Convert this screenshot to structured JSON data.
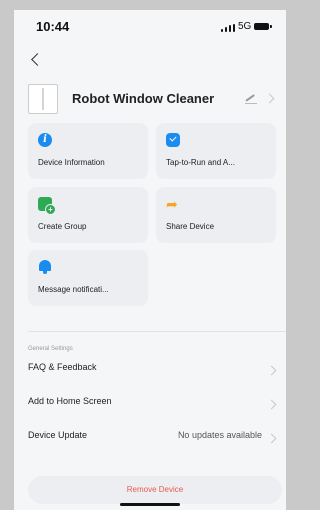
{
  "status_bar": {
    "time": "10:44",
    "network": "5G"
  },
  "header": {
    "back_icon": "chevron-left-icon"
  },
  "device": {
    "name": "Robot Window Cleaner",
    "edit_icon": "pencil-icon"
  },
  "tiles": [
    {
      "label": "Device Information",
      "icon": "info-icon",
      "color": "#1a8cf0"
    },
    {
      "label": "Tap-to-Run and A...",
      "icon": "check-badge-icon",
      "color": "#1a8cf0"
    },
    {
      "label": "Create Group",
      "icon": "group-add-icon",
      "color": "#2eaa55"
    },
    {
      "label": "Share Device",
      "icon": "share-arrow-icon",
      "color": "#f5a623"
    },
    {
      "label": "Message notificati...",
      "icon": "bell-icon",
      "color": "#1a8cf0"
    }
  ],
  "general_settings": {
    "section_label": "General Settings",
    "items": [
      {
        "label": "FAQ & Feedback",
        "value": ""
      },
      {
        "label": "Add to Home Screen",
        "value": ""
      },
      {
        "label": "Device Update",
        "value": "No updates available"
      }
    ]
  },
  "remove_button": {
    "label": "Remove Device",
    "color": "#e85a4f"
  }
}
